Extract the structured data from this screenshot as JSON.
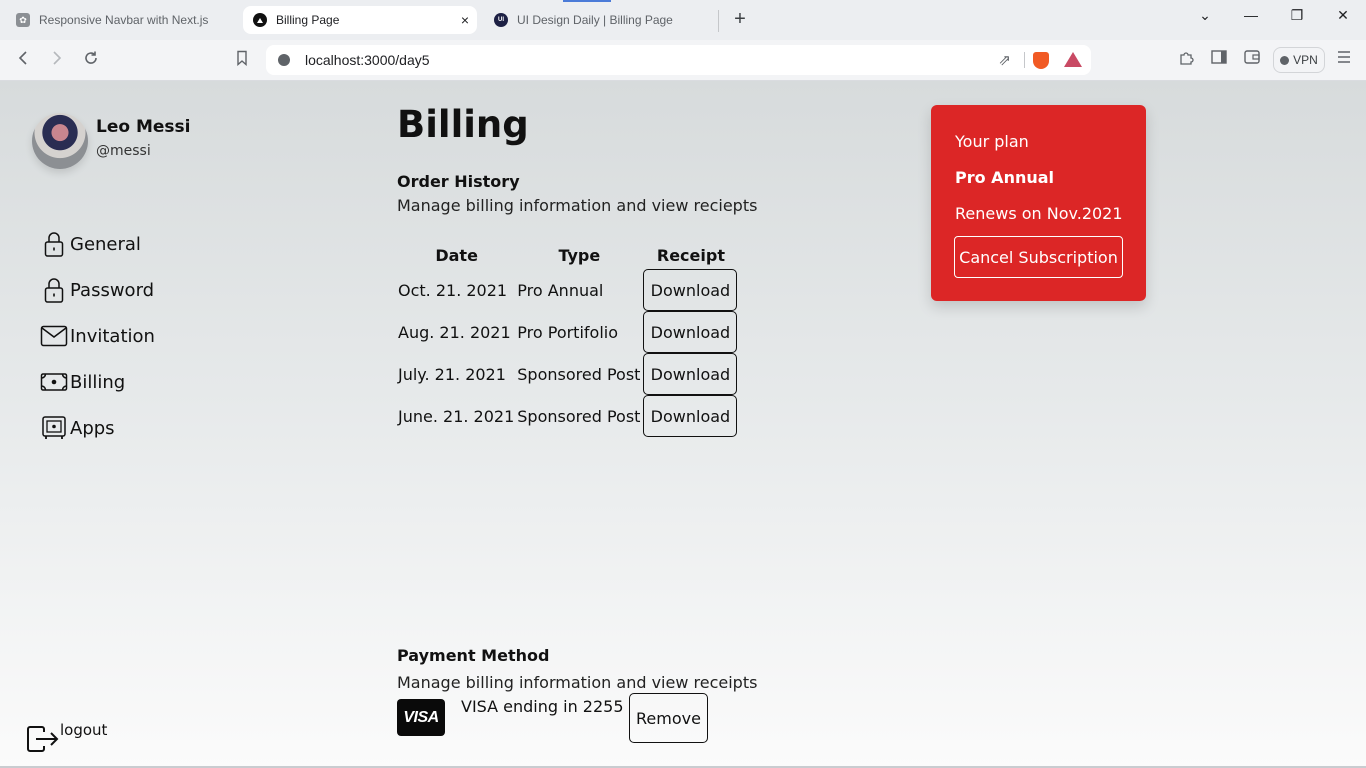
{
  "browser": {
    "tabs": [
      {
        "title": "Responsive Navbar with Next.js",
        "icon": "openai-icon",
        "active": false
      },
      {
        "title": "Billing Page",
        "icon": "nextjs-icon",
        "active": true
      },
      {
        "title": "UI Design Daily | Billing Page",
        "icon": "uidesigndaily-icon",
        "active": false
      }
    ],
    "tab_close": "×",
    "new_tab": "+",
    "url": "localhost:3000/day5",
    "vpn_label": "VPN",
    "window_controls": {
      "dropdown": "⌄",
      "minimize": "—",
      "restore": "❐",
      "close": "✕"
    }
  },
  "profile": {
    "name": "Leo Messi",
    "handle": "@messi"
  },
  "sidebar": {
    "items": [
      {
        "label": "General",
        "icon": "lock-icon"
      },
      {
        "label": "Password",
        "icon": "lock-icon"
      },
      {
        "label": "Invitation",
        "icon": "mail-icon"
      },
      {
        "label": "Billing",
        "icon": "money-icon"
      },
      {
        "label": "Apps",
        "icon": "safe-icon"
      }
    ],
    "logout_label": "logout"
  },
  "main": {
    "title": "Billing",
    "order_history": {
      "title": "Order History",
      "description": "Manage billing information and view reciepts",
      "columns": [
        "Date",
        "Type",
        "Receipt"
      ],
      "rows": [
        {
          "date": "Oct. 21. 2021",
          "type": "Pro Annual",
          "action": "Download"
        },
        {
          "date": "Aug. 21. 2021",
          "type": "Pro Portifolio",
          "action": "Download"
        },
        {
          "date": "July. 21. 2021",
          "type": "Sponsored Post",
          "action": "Download"
        },
        {
          "date": "June. 21. 2021",
          "type": "Sponsored Post",
          "action": "Download"
        }
      ]
    },
    "payment_method": {
      "title": "Payment Method",
      "description": "Manage billing information and view receipts",
      "card_brand": "VISA",
      "card_text": "VISA ending in 2255",
      "remove_label": "Remove"
    }
  },
  "plan": {
    "label": "Your plan",
    "name": "Pro Annual",
    "renews": "Renews on Nov.2021",
    "cancel_label": "Cancel Subscription",
    "color": "#dc2626"
  }
}
